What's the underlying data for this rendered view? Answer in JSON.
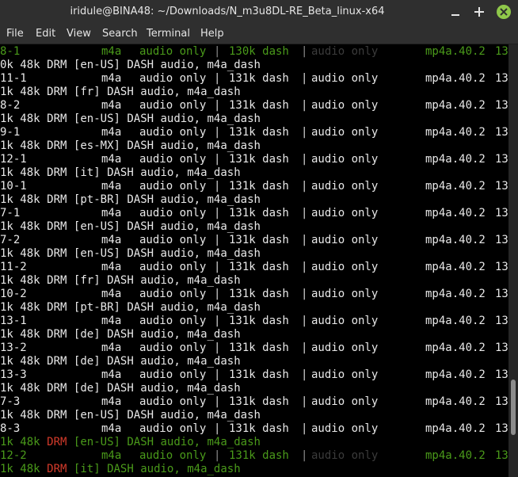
{
  "window": {
    "title": "iridule@BINA48: ~/Downloads/N_m3u8DL-RE_Beta_linux-x64",
    "minimize_glyph": "–",
    "maximize_glyph": "+",
    "close_glyph": "✕",
    "close_color": "#8fc84a"
  },
  "menu": [
    "File",
    "Edit",
    "View",
    "Search",
    "Terminal",
    "Help"
  ],
  "colors": {
    "background": "#000000",
    "text": "#e8e8e8",
    "highlight_green": "#4a9a1a",
    "drm_red": "#d23a2a"
  },
  "lines": [
    {
      "type": "track",
      "style": "dim",
      "id": "8-1",
      "ext": "m4a",
      "kind": "audio only",
      "sep1": "|",
      "bitrate": "130k dash",
      "sep2": "|",
      "kind2": "audio only",
      "codec": "mp4a.40.2",
      "tail": "13"
    },
    {
      "type": "info",
      "style": "normal",
      "pre": "0k 48k ",
      "drm": "DRM",
      "post": " [en-US] DASH audio, m4a_dash"
    },
    {
      "type": "track",
      "style": "normal",
      "id": "11-1",
      "ext": "m4a",
      "kind": "audio only",
      "sep1": "|",
      "bitrate": "131k dash",
      "sep2": "|",
      "kind2": "audio only",
      "codec": "mp4a.40.2",
      "tail": "13"
    },
    {
      "type": "info",
      "style": "normal",
      "pre": "1k 48k ",
      "drm": "DRM",
      "post": " [fr] DASH audio, m4a_dash"
    },
    {
      "type": "track",
      "style": "normal",
      "id": "8-2",
      "ext": "m4a",
      "kind": "audio only",
      "sep1": "|",
      "bitrate": "131k dash",
      "sep2": "|",
      "kind2": "audio only",
      "codec": "mp4a.40.2",
      "tail": "13"
    },
    {
      "type": "info",
      "style": "normal",
      "pre": "1k 48k ",
      "drm": "DRM",
      "post": " [en-US] DASH audio, m4a_dash"
    },
    {
      "type": "track",
      "style": "normal",
      "id": "9-1",
      "ext": "m4a",
      "kind": "audio only",
      "sep1": "|",
      "bitrate": "131k dash",
      "sep2": "|",
      "kind2": "audio only",
      "codec": "mp4a.40.2",
      "tail": "13"
    },
    {
      "type": "info",
      "style": "normal",
      "pre": "1k 48k ",
      "drm": "DRM",
      "post": " [es-MX] DASH audio, m4a_dash"
    },
    {
      "type": "track",
      "style": "normal",
      "id": "12-1",
      "ext": "m4a",
      "kind": "audio only",
      "sep1": "|",
      "bitrate": "131k dash",
      "sep2": "|",
      "kind2": "audio only",
      "codec": "mp4a.40.2",
      "tail": "13"
    },
    {
      "type": "info",
      "style": "normal",
      "pre": "1k 48k ",
      "drm": "DRM",
      "post": " [it] DASH audio, m4a_dash"
    },
    {
      "type": "track",
      "style": "normal",
      "id": "10-1",
      "ext": "m4a",
      "kind": "audio only",
      "sep1": "|",
      "bitrate": "131k dash",
      "sep2": "|",
      "kind2": "audio only",
      "codec": "mp4a.40.2",
      "tail": "13"
    },
    {
      "type": "info",
      "style": "normal",
      "pre": "1k 48k ",
      "drm": "DRM",
      "post": " [pt-BR] DASH audio, m4a_dash"
    },
    {
      "type": "track",
      "style": "normal",
      "id": "7-1",
      "ext": "m4a",
      "kind": "audio only",
      "sep1": "|",
      "bitrate": "131k dash",
      "sep2": "|",
      "kind2": "audio only",
      "codec": "mp4a.40.2",
      "tail": "13"
    },
    {
      "type": "info",
      "style": "normal",
      "pre": "1k 48k ",
      "drm": "DRM",
      "post": " [en-US] DASH audio, m4a_dash"
    },
    {
      "type": "track",
      "style": "normal",
      "id": "7-2",
      "ext": "m4a",
      "kind": "audio only",
      "sep1": "|",
      "bitrate": "131k dash",
      "sep2": "|",
      "kind2": "audio only",
      "codec": "mp4a.40.2",
      "tail": "13"
    },
    {
      "type": "info",
      "style": "normal",
      "pre": "1k 48k ",
      "drm": "DRM",
      "post": " [en-US] DASH audio, m4a_dash"
    },
    {
      "type": "track",
      "style": "normal",
      "id": "11-2",
      "ext": "m4a",
      "kind": "audio only",
      "sep1": "|",
      "bitrate": "131k dash",
      "sep2": "|",
      "kind2": "audio only",
      "codec": "mp4a.40.2",
      "tail": "13"
    },
    {
      "type": "info",
      "style": "normal",
      "pre": "1k 48k ",
      "drm": "DRM",
      "post": " [fr] DASH audio, m4a_dash"
    },
    {
      "type": "track",
      "style": "normal",
      "id": "10-2",
      "ext": "m4a",
      "kind": "audio only",
      "sep1": "|",
      "bitrate": "131k dash",
      "sep2": "|",
      "kind2": "audio only",
      "codec": "mp4a.40.2",
      "tail": "13"
    },
    {
      "type": "info",
      "style": "normal",
      "pre": "1k 48k ",
      "drm": "DRM",
      "post": " [pt-BR] DASH audio, m4a_dash"
    },
    {
      "type": "track",
      "style": "normal",
      "id": "13-1",
      "ext": "m4a",
      "kind": "audio only",
      "sep1": "|",
      "bitrate": "131k dash",
      "sep2": "|",
      "kind2": "audio only",
      "codec": "mp4a.40.2",
      "tail": "13"
    },
    {
      "type": "info",
      "style": "normal",
      "pre": "1k 48k ",
      "drm": "DRM",
      "post": " [de] DASH audio, m4a_dash"
    },
    {
      "type": "track",
      "style": "normal",
      "id": "13-2",
      "ext": "m4a",
      "kind": "audio only",
      "sep1": "|",
      "bitrate": "131k dash",
      "sep2": "|",
      "kind2": "audio only",
      "codec": "mp4a.40.2",
      "tail": "13"
    },
    {
      "type": "info",
      "style": "normal",
      "pre": "1k 48k ",
      "drm": "DRM",
      "post": " [de] DASH audio, m4a_dash"
    },
    {
      "type": "track",
      "style": "normal",
      "id": "13-3",
      "ext": "m4a",
      "kind": "audio only",
      "sep1": "|",
      "bitrate": "131k dash",
      "sep2": "|",
      "kind2": "audio only",
      "codec": "mp4a.40.2",
      "tail": "13"
    },
    {
      "type": "info",
      "style": "normal",
      "pre": "1k 48k ",
      "drm": "DRM",
      "post": " [de] DASH audio, m4a_dash"
    },
    {
      "type": "track",
      "style": "normal",
      "id": "7-3",
      "ext": "m4a",
      "kind": "audio only",
      "sep1": "|",
      "bitrate": "131k dash",
      "sep2": "|",
      "kind2": "audio only",
      "codec": "mp4a.40.2",
      "tail": "13"
    },
    {
      "type": "info",
      "style": "normal",
      "pre": "1k 48k ",
      "drm": "DRM",
      "post": " [en-US] DASH audio, m4a_dash"
    },
    {
      "type": "track",
      "style": "normal",
      "id": "8-3",
      "ext": "m4a",
      "kind": "audio only",
      "sep1": "|",
      "bitrate": "131k dash",
      "sep2": "|",
      "kind2": "audio only",
      "codec": "mp4a.40.2",
      "tail": "13"
    },
    {
      "type": "info",
      "style": "dim",
      "pre": "1k 48k ",
      "drm": "DRM",
      "post": " [en-US] DASH audio, m4a_dash"
    },
    {
      "type": "track",
      "style": "dim",
      "id": "12-2",
      "ext": "m4a",
      "kind": "audio only",
      "sep1": "|",
      "bitrate": "131k dash",
      "sep2": "|",
      "kind2": "audio only",
      "codec": "mp4a.40.2",
      "tail": "13"
    },
    {
      "type": "info",
      "style": "dim",
      "pre": "1k 48k ",
      "drm": "DRM",
      "post": " [it] DASH audio, m4a_dash"
    }
  ]
}
